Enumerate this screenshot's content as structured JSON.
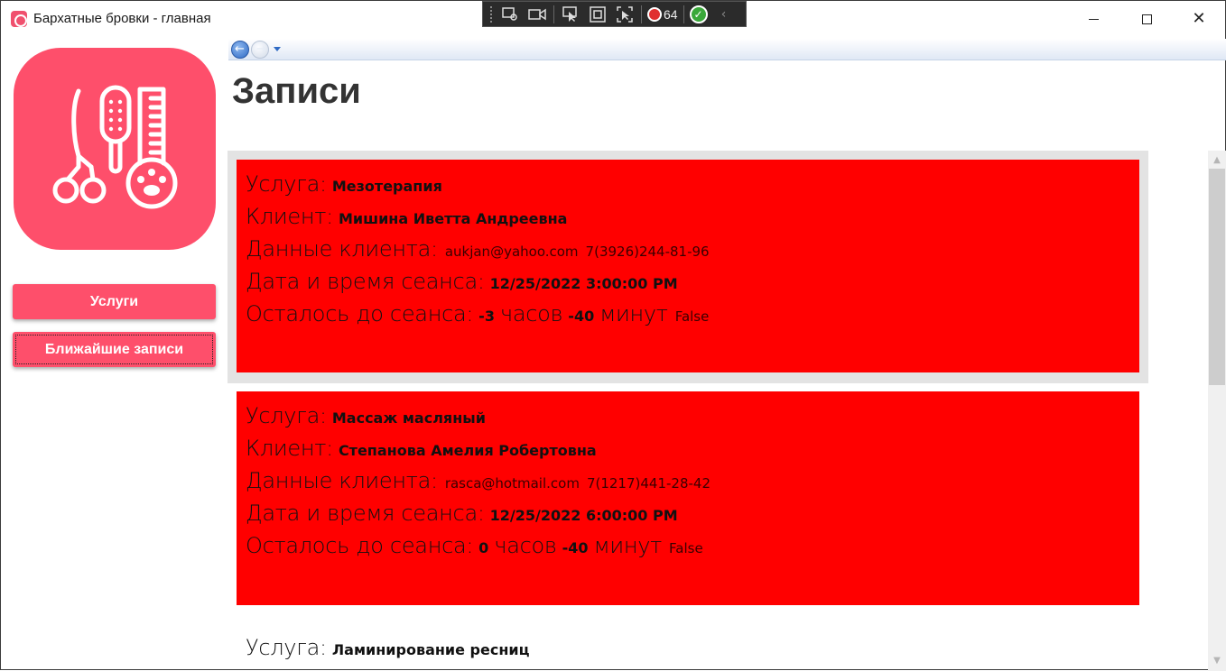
{
  "window": {
    "title": "Бархатные бровки - главная",
    "accent": "#fe4f6b"
  },
  "debug_toolbar": {
    "error_count": "64"
  },
  "sidebar": {
    "logo_icon": "beauty-tools-icon",
    "buttons": [
      {
        "label": "Услуги"
      },
      {
        "label": "Ближайшие записи"
      }
    ]
  },
  "main": {
    "title": "Записи",
    "labels": {
      "service": "Услуга:",
      "client": "Клиент:",
      "client_data": "Данные клиента:",
      "datetime": "Дата и время сеанса:",
      "remaining": "Осталось до сеанса:",
      "hours": "часов",
      "minutes": "минут"
    },
    "records": [
      {
        "service": "Мезотерапия",
        "client": "Мишина  Иветта  Андреевна",
        "email": "aukjan@yahoo.com",
        "phone": "7(3926)244-81-96",
        "datetime": "12/25/2022 3:00:00 PM",
        "hours_left": "-3",
        "minutes_left": "-40",
        "flag": "False",
        "highlight_color": "#ff0000"
      },
      {
        "service": "Массаж масляный",
        "client": "Степанова  Амелия  Робертовна",
        "email": "rasca@hotmail.com",
        "phone": "7(1217)441-28-42",
        "datetime": "12/25/2022 6:00:00 PM",
        "hours_left": "0",
        "minutes_left": "-40",
        "flag": "False",
        "highlight_color": "#ff0000"
      },
      {
        "service": "Ламинирование ресниц"
      }
    ]
  }
}
